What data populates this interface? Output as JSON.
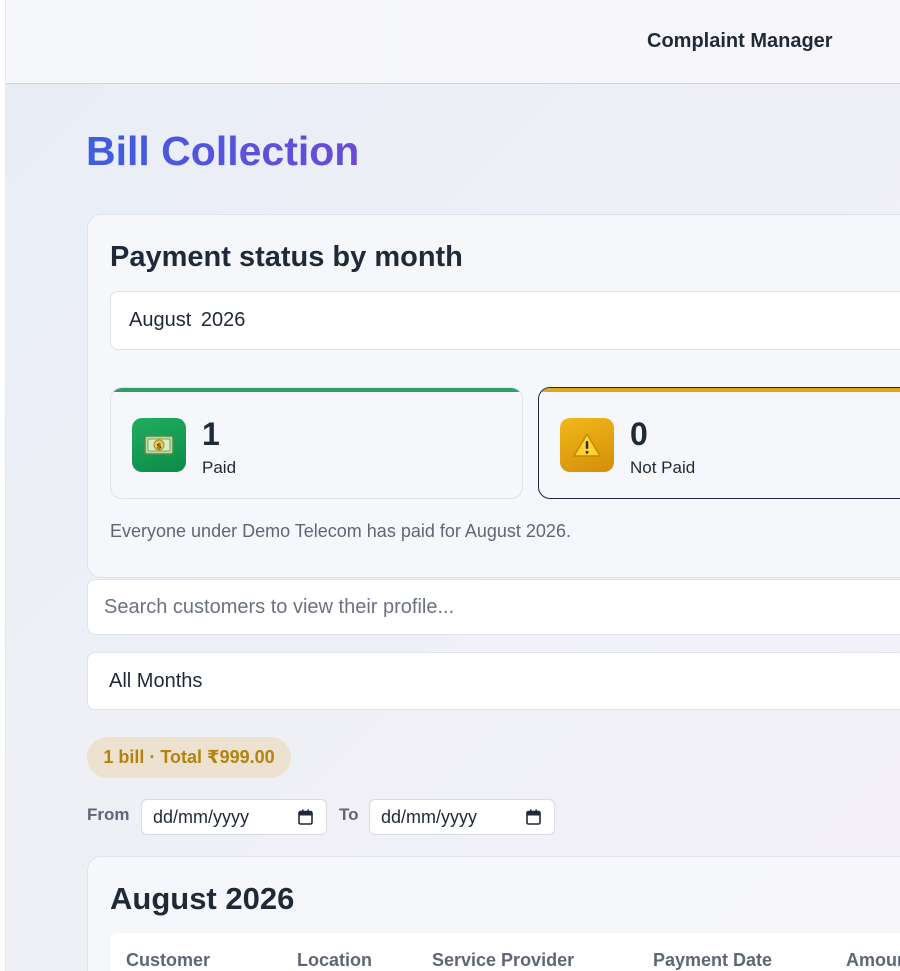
{
  "header": {
    "title": "Complaint Manager"
  },
  "page": {
    "title": "Bill Collection"
  },
  "status_card": {
    "heading": "Payment status by month",
    "selected_month": "August 2026",
    "paid": {
      "count": "1",
      "label": "Paid",
      "icon": "money-icon",
      "accent": "#2f9d66"
    },
    "not_paid": {
      "count": "0",
      "label": "Not Paid",
      "icon": "warning-icon",
      "accent": "#e0a81e"
    },
    "note": "Everyone under Demo Telecom has paid for August 2026."
  },
  "search": {
    "placeholder": "Search customers to view their profile..."
  },
  "filter": {
    "selected": "All Months"
  },
  "summary": {
    "badge": "1 bill · Total ₹999.00"
  },
  "date_range": {
    "from_label": "From",
    "to_label": "To",
    "from_value": "dd/mm/yyyy",
    "to_value": "dd/mm/yyyy"
  },
  "month_section": {
    "heading": "August 2026",
    "columns": [
      "Customer",
      "Location",
      "Service Provider",
      "Payment Date",
      "Amount"
    ]
  },
  "colors": {
    "title_gradient_start": "#3f5de0",
    "title_gradient_end": "#6c4ad8",
    "badge_text": "#b4830f"
  }
}
